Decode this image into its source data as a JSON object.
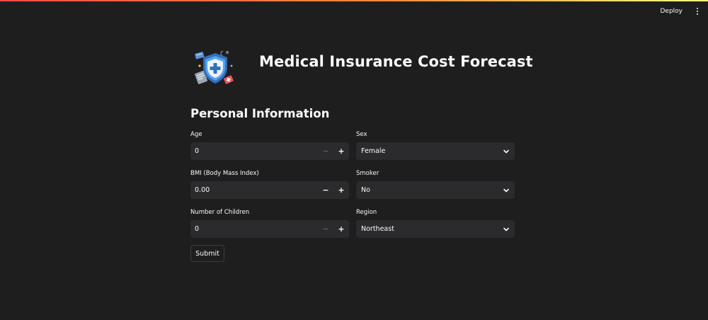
{
  "header": {
    "deploy_label": "Deploy"
  },
  "page": {
    "title": "Medical Insurance Cost Forecast",
    "section_title": "Personal Information",
    "logo_icon": "medical-insurance-shield-icon"
  },
  "form": {
    "age": {
      "label": "Age",
      "value": "0"
    },
    "sex": {
      "label": "Sex",
      "value": "Female"
    },
    "bmi": {
      "label": "BMI (Body Mass Index)",
      "value": "0.00"
    },
    "smoker": {
      "label": "Smoker",
      "value": "No"
    },
    "children": {
      "label": "Number of Children",
      "value": "0"
    },
    "region": {
      "label": "Region",
      "value": "Northeast"
    },
    "minus_symbol": "−",
    "plus_symbol": "+",
    "submit_label": "Submit"
  },
  "colors": {
    "background": "#1e1e1e",
    "input_bg": "#2b2b2e",
    "text": "#fafafa",
    "accent_gradient_start": "#ff4b4b",
    "accent_gradient_end": "#fffd80"
  }
}
